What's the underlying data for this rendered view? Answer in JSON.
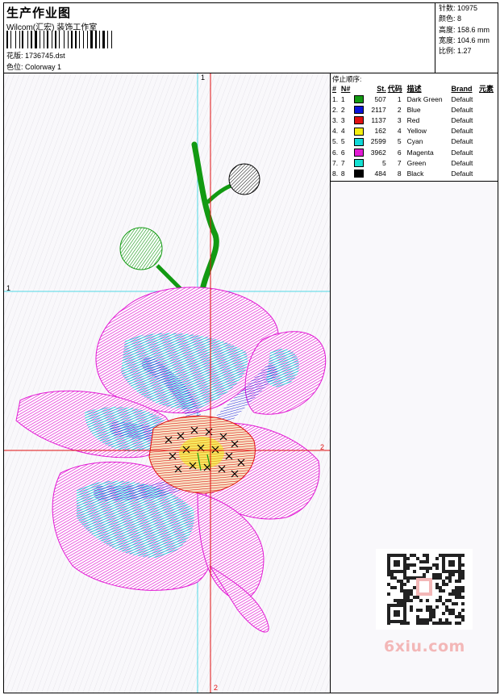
{
  "header": {
    "title": "生产作业图",
    "company": "Wilcom(汇宏) 装饰工作室",
    "file_label": "花版:",
    "file_value": "1736745.dst",
    "colorway_label": "色位:",
    "colorway_value": "Colorway 1"
  },
  "stats": {
    "stitches_label": "针数:",
    "stitches_value": "10975",
    "colors_label": "颜色:",
    "colors_value": "8",
    "height_label": "高度:",
    "height_value": "158.6 mm",
    "width_label": "宽度:",
    "width_value": "104.6 mm",
    "scale_label": "比例:",
    "scale_value": "1.27"
  },
  "stop_sequence": {
    "title": "停止顺序:",
    "columns": [
      "#",
      "N#",
      "St.",
      "代码",
      "描述",
      "Brand",
      "元素"
    ],
    "rows": [
      {
        "num": "1.",
        "n": "1",
        "color": "#129a12",
        "st": "507",
        "code": "1",
        "desc": "Dark Green",
        "brand": "Default"
      },
      {
        "num": "2.",
        "n": "2",
        "color": "#0a14d8",
        "st": "2117",
        "code": "2",
        "desc": "Blue",
        "brand": "Default"
      },
      {
        "num": "3.",
        "n": "3",
        "color": "#e01010",
        "st": "1137",
        "code": "3",
        "desc": "Red",
        "brand": "Default"
      },
      {
        "num": "4.",
        "n": "4",
        "color": "#f4ee10",
        "st": "162",
        "code": "4",
        "desc": "Yellow",
        "brand": "Default"
      },
      {
        "num": "5.",
        "n": "5",
        "color": "#10d8d8",
        "st": "2599",
        "code": "5",
        "desc": "Cyan",
        "brand": "Default"
      },
      {
        "num": "6.",
        "n": "6",
        "color": "#e21ad4",
        "st": "3962",
        "code": "6",
        "desc": "Magenta",
        "brand": "Default"
      },
      {
        "num": "7.",
        "n": "7",
        "color": "#14e0d2",
        "st": "5",
        "code": "7",
        "desc": "Green",
        "brand": "Default"
      },
      {
        "num": "8.",
        "n": "8",
        "color": "#000000",
        "st": "484",
        "code": "8",
        "desc": "Black",
        "brand": "Default"
      }
    ]
  },
  "markers": {
    "guide1": "1",
    "guide2": "2"
  },
  "watermark": "6xiu.com"
}
